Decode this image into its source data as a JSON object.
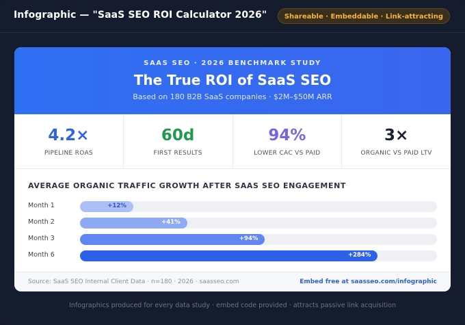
{
  "header": {
    "title": "Infographic — \"SaaS SEO ROI Calculator 2026\"",
    "badge": "Shareable · Embeddable · Link-attracting"
  },
  "hero": {
    "eyebrow": "SAAS SEO · 2026 BENCHMARK STUDY",
    "title": "The True ROI of SaaS SEO",
    "subtitle": "Based on 180 B2B SaaS companies · $2M–$50M ARR"
  },
  "stats": [
    {
      "value": "4.2×",
      "label": "PIPELINE ROAS",
      "color": "#2f63e0"
    },
    {
      "value": "60d",
      "label": "FIRST RESULTS",
      "color": "#1f9a4e"
    },
    {
      "value": "94%",
      "label": "LOWER CAC VS PAID",
      "color": "#7a63e6"
    },
    {
      "value": "3×",
      "label": "ORGANIC VS PAID LTV",
      "color": "#1b2030"
    }
  ],
  "chart": {
    "title": "AVERAGE ORGANIC TRAFFIC GROWTH AFTER SAAS SEO ENGAGEMENT",
    "rows": [
      {
        "label": "Month 1",
        "value": "+12%",
        "fraction": 0.149,
        "color": "#aebff5",
        "text_color": "#2d52c8"
      },
      {
        "label": "Month 2",
        "value": "+41%",
        "fraction": 0.3,
        "color": "#8eaaf5",
        "text_color": "#ffffff"
      },
      {
        "label": "Month 3",
        "value": "+94%",
        "fraction": 0.518,
        "color": "#5f86f2",
        "text_color": "#ffffff"
      },
      {
        "label": "Month 6",
        "value": "+284%",
        "fraction": 0.834,
        "color": "#2d62e8",
        "text_color": "#ffffff"
      }
    ]
  },
  "footer": {
    "source": "Source: SaaS SEO Internal Client Data · n=180 · 2026 · saasseo.com",
    "embed": "Embed free at saasseo.com/infographic"
  },
  "caption": "Infographics produced for every data study · embed code provided · attracts passive link acquisition"
}
